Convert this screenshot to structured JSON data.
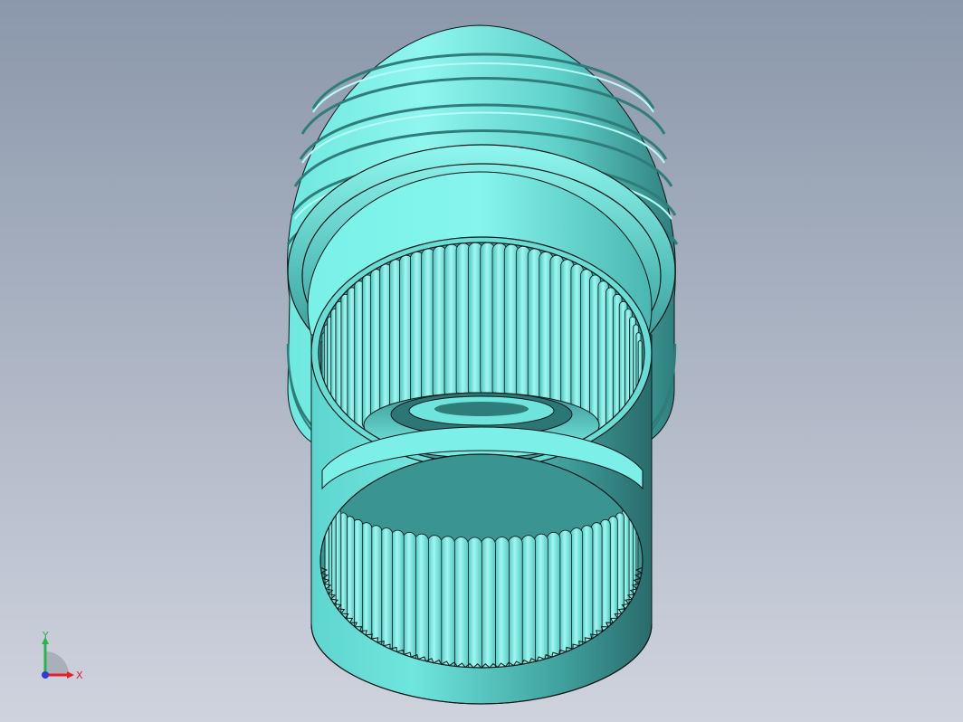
{
  "colors": {
    "background_top": "#8b98ab",
    "background_bottom": "#cfd3de",
    "part_base": "#73f0e6",
    "part_light": "#9ff8f1",
    "part_mid": "#5fd6cf",
    "part_dark": "#2f7d7b",
    "part_deep": "#1f5f60",
    "edge": "#0c1818",
    "axis_x": "#e5202a",
    "axis_y": "#28b54a",
    "axis_z": "#2a3fd0"
  },
  "triad": {
    "x_label": "X",
    "y_label": "Y"
  }
}
